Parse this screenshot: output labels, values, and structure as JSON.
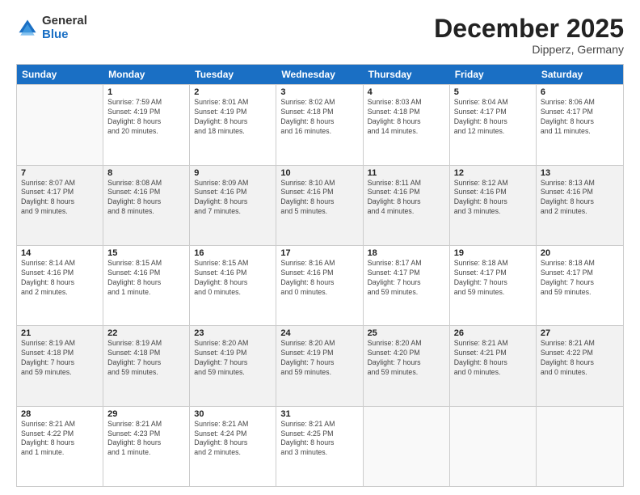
{
  "logo": {
    "general": "General",
    "blue": "Blue"
  },
  "header": {
    "month": "December 2025",
    "location": "Dipperz, Germany"
  },
  "weekdays": [
    "Sunday",
    "Monday",
    "Tuesday",
    "Wednesday",
    "Thursday",
    "Friday",
    "Saturday"
  ],
  "rows": [
    [
      {
        "date": "",
        "info": ""
      },
      {
        "date": "1",
        "info": "Sunrise: 7:59 AM\nSunset: 4:19 PM\nDaylight: 8 hours\nand 20 minutes."
      },
      {
        "date": "2",
        "info": "Sunrise: 8:01 AM\nSunset: 4:19 PM\nDaylight: 8 hours\nand 18 minutes."
      },
      {
        "date": "3",
        "info": "Sunrise: 8:02 AM\nSunset: 4:18 PM\nDaylight: 8 hours\nand 16 minutes."
      },
      {
        "date": "4",
        "info": "Sunrise: 8:03 AM\nSunset: 4:18 PM\nDaylight: 8 hours\nand 14 minutes."
      },
      {
        "date": "5",
        "info": "Sunrise: 8:04 AM\nSunset: 4:17 PM\nDaylight: 8 hours\nand 12 minutes."
      },
      {
        "date": "6",
        "info": "Sunrise: 8:06 AM\nSunset: 4:17 PM\nDaylight: 8 hours\nand 11 minutes."
      }
    ],
    [
      {
        "date": "7",
        "info": "Sunrise: 8:07 AM\nSunset: 4:17 PM\nDaylight: 8 hours\nand 9 minutes."
      },
      {
        "date": "8",
        "info": "Sunrise: 8:08 AM\nSunset: 4:16 PM\nDaylight: 8 hours\nand 8 minutes."
      },
      {
        "date": "9",
        "info": "Sunrise: 8:09 AM\nSunset: 4:16 PM\nDaylight: 8 hours\nand 7 minutes."
      },
      {
        "date": "10",
        "info": "Sunrise: 8:10 AM\nSunset: 4:16 PM\nDaylight: 8 hours\nand 5 minutes."
      },
      {
        "date": "11",
        "info": "Sunrise: 8:11 AM\nSunset: 4:16 PM\nDaylight: 8 hours\nand 4 minutes."
      },
      {
        "date": "12",
        "info": "Sunrise: 8:12 AM\nSunset: 4:16 PM\nDaylight: 8 hours\nand 3 minutes."
      },
      {
        "date": "13",
        "info": "Sunrise: 8:13 AM\nSunset: 4:16 PM\nDaylight: 8 hours\nand 2 minutes."
      }
    ],
    [
      {
        "date": "14",
        "info": "Sunrise: 8:14 AM\nSunset: 4:16 PM\nDaylight: 8 hours\nand 2 minutes."
      },
      {
        "date": "15",
        "info": "Sunrise: 8:15 AM\nSunset: 4:16 PM\nDaylight: 8 hours\nand 1 minute."
      },
      {
        "date": "16",
        "info": "Sunrise: 8:15 AM\nSunset: 4:16 PM\nDaylight: 8 hours\nand 0 minutes."
      },
      {
        "date": "17",
        "info": "Sunrise: 8:16 AM\nSunset: 4:16 PM\nDaylight: 8 hours\nand 0 minutes."
      },
      {
        "date": "18",
        "info": "Sunrise: 8:17 AM\nSunset: 4:17 PM\nDaylight: 7 hours\nand 59 minutes."
      },
      {
        "date": "19",
        "info": "Sunrise: 8:18 AM\nSunset: 4:17 PM\nDaylight: 7 hours\nand 59 minutes."
      },
      {
        "date": "20",
        "info": "Sunrise: 8:18 AM\nSunset: 4:17 PM\nDaylight: 7 hours\nand 59 minutes."
      }
    ],
    [
      {
        "date": "21",
        "info": "Sunrise: 8:19 AM\nSunset: 4:18 PM\nDaylight: 7 hours\nand 59 minutes."
      },
      {
        "date": "22",
        "info": "Sunrise: 8:19 AM\nSunset: 4:18 PM\nDaylight: 7 hours\nand 59 minutes."
      },
      {
        "date": "23",
        "info": "Sunrise: 8:20 AM\nSunset: 4:19 PM\nDaylight: 7 hours\nand 59 minutes."
      },
      {
        "date": "24",
        "info": "Sunrise: 8:20 AM\nSunset: 4:19 PM\nDaylight: 7 hours\nand 59 minutes."
      },
      {
        "date": "25",
        "info": "Sunrise: 8:20 AM\nSunset: 4:20 PM\nDaylight: 7 hours\nand 59 minutes."
      },
      {
        "date": "26",
        "info": "Sunrise: 8:21 AM\nSunset: 4:21 PM\nDaylight: 8 hours\nand 0 minutes."
      },
      {
        "date": "27",
        "info": "Sunrise: 8:21 AM\nSunset: 4:22 PM\nDaylight: 8 hours\nand 0 minutes."
      }
    ],
    [
      {
        "date": "28",
        "info": "Sunrise: 8:21 AM\nSunset: 4:22 PM\nDaylight: 8 hours\nand 1 minute."
      },
      {
        "date": "29",
        "info": "Sunrise: 8:21 AM\nSunset: 4:23 PM\nDaylight: 8 hours\nand 1 minute."
      },
      {
        "date": "30",
        "info": "Sunrise: 8:21 AM\nSunset: 4:24 PM\nDaylight: 8 hours\nand 2 minutes."
      },
      {
        "date": "31",
        "info": "Sunrise: 8:21 AM\nSunset: 4:25 PM\nDaylight: 8 hours\nand 3 minutes."
      },
      {
        "date": "",
        "info": ""
      },
      {
        "date": "",
        "info": ""
      },
      {
        "date": "",
        "info": ""
      }
    ]
  ]
}
